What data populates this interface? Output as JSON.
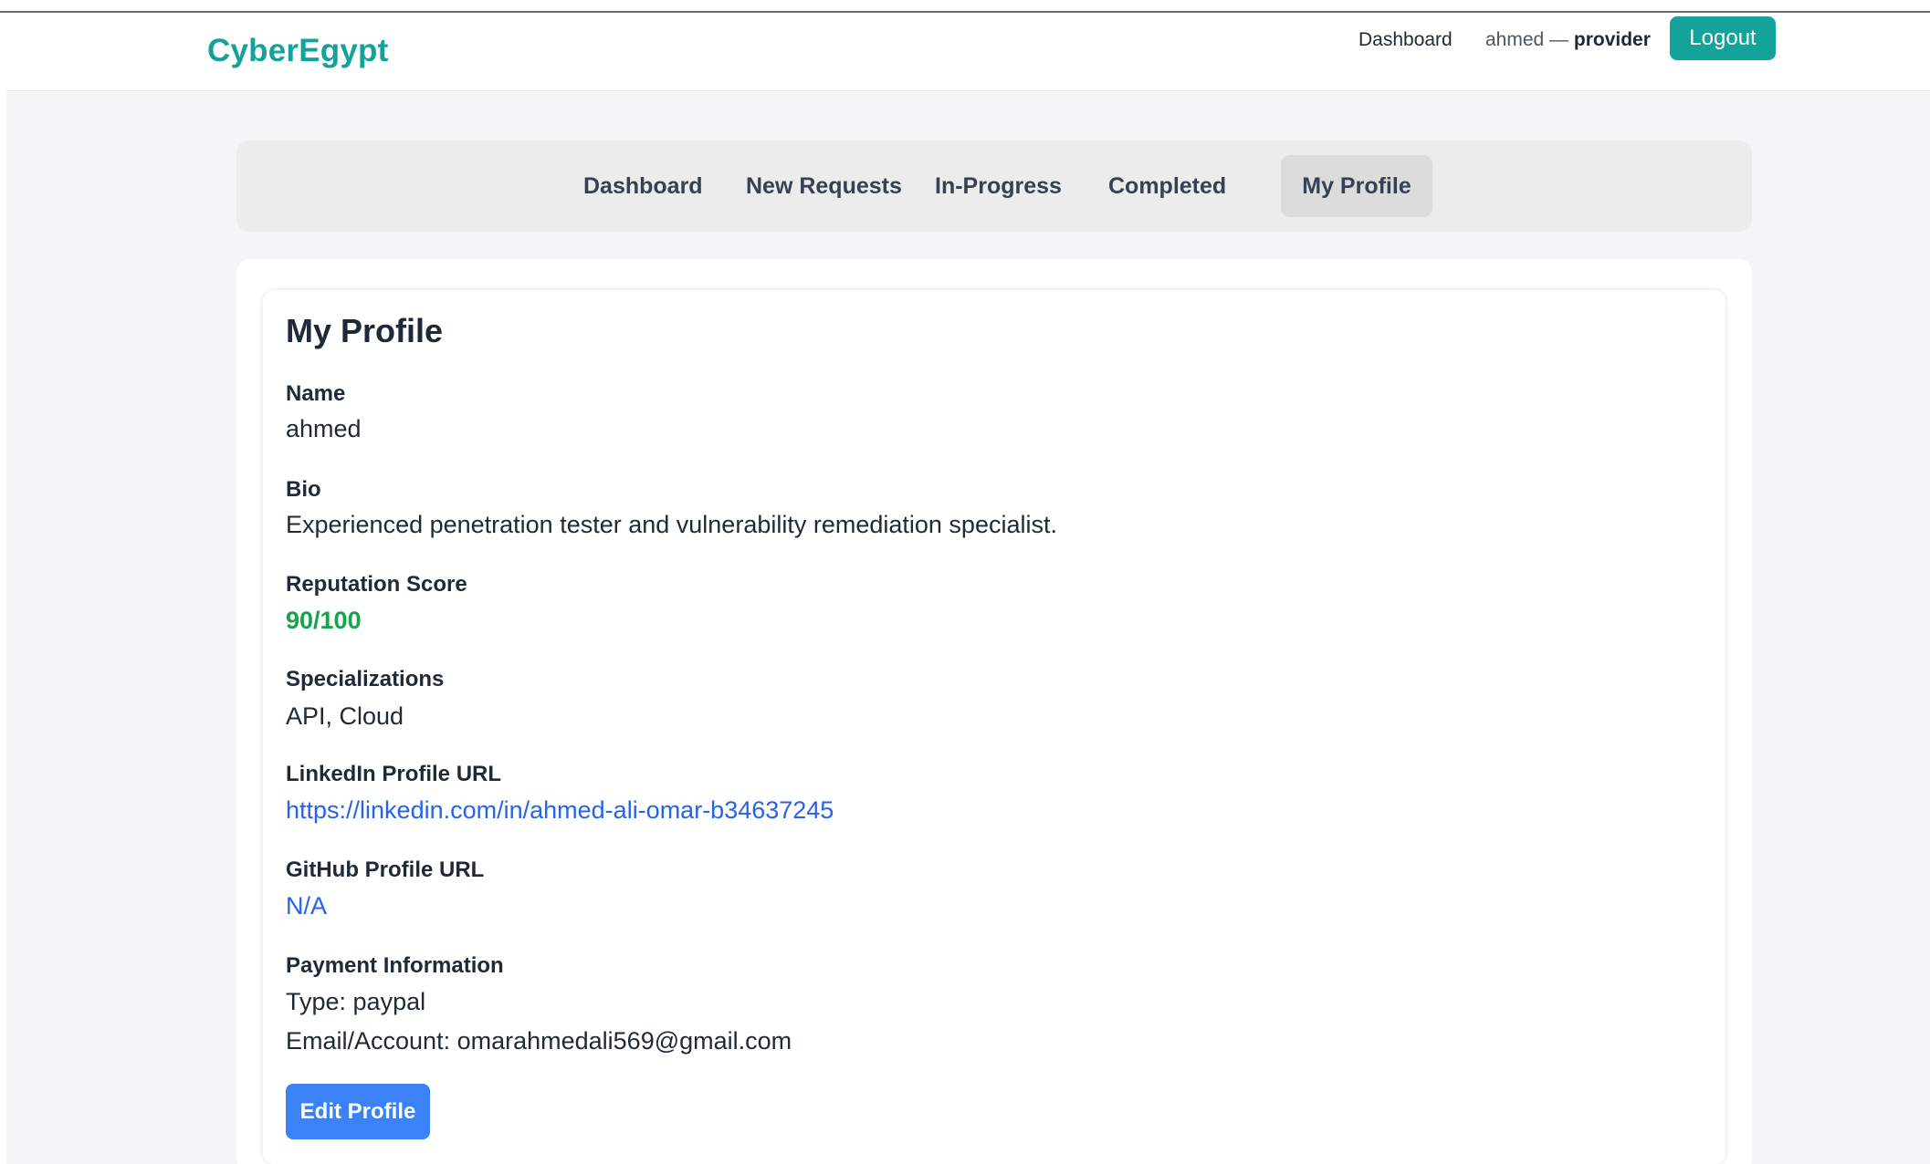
{
  "header": {
    "brand": "CyberEgypt",
    "dashboard_link": "Dashboard",
    "user_name": "ahmed",
    "user_separator": " — ",
    "user_role": "provider",
    "logout_label": "Logout"
  },
  "tabs": [
    {
      "label": "Dashboard"
    },
    {
      "label": "New Requests"
    },
    {
      "label": "In-Progress"
    },
    {
      "label": "Completed"
    },
    {
      "label": "My Profile",
      "active": true
    }
  ],
  "profile": {
    "title": "My Profile",
    "name_label": "Name",
    "name_value": "ahmed",
    "bio_label": "Bio",
    "bio_value": "Experienced penetration tester and vulnerability remediation specialist.",
    "reputation_label": "Reputation Score",
    "reputation_value": "90/100",
    "specializations_label": "Specializations",
    "specializations_value": "API, Cloud",
    "linkedin_label": "LinkedIn Profile URL",
    "linkedin_value": "https://linkedin.com/in/ahmed-ali-omar-b34637245",
    "github_label": "GitHub Profile URL",
    "github_value": "N/A",
    "payment_label": "Payment Information",
    "payment_type": "Type: paypal",
    "payment_account": "Email/Account: omarahmedali569@gmail.com",
    "edit_label": "Edit Profile"
  },
  "colors": {
    "brand": "#14a39a",
    "score": "#16a34a",
    "link": "#2563eb",
    "primary_button": "#3b82f6"
  }
}
